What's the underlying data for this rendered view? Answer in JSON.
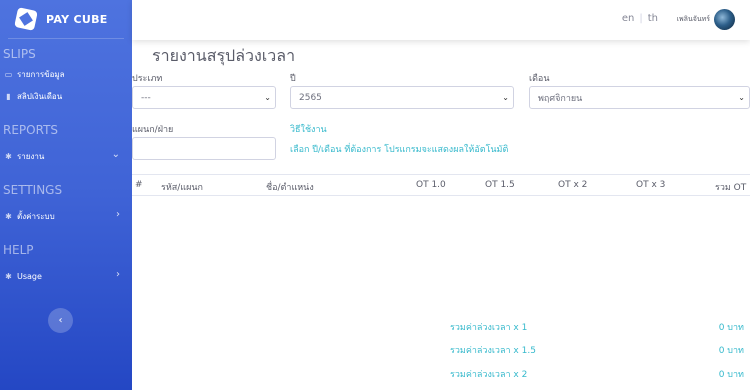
{
  "brand": {
    "name": "PAY CUBE"
  },
  "sidebar": {
    "sections": [
      {
        "title": "SLIPS",
        "items": [
          {
            "label": "รายการข้อมูล",
            "icon": "table-icon"
          },
          {
            "label": "สลิปเงินเดือน",
            "icon": "file-icon"
          }
        ]
      },
      {
        "title": "REPORTS",
        "items": [
          {
            "label": "รายงาน",
            "icon": "gear-icon"
          }
        ]
      },
      {
        "title": "SETTINGS",
        "items": [
          {
            "label": "ตั้งค่าระบบ",
            "icon": "gear-icon"
          }
        ]
      },
      {
        "title": "HELP",
        "items": [
          {
            "label": "Usage",
            "icon": "gear-icon"
          }
        ]
      }
    ],
    "collapse_label": "‹"
  },
  "topbar": {
    "lang_en": "en",
    "lang_th": "th",
    "user_name": "เพลินจันทร์"
  },
  "page": {
    "title": "รายงานสรุปล่วงเวลา"
  },
  "filters": {
    "type_label": "ประเภท",
    "type_value": "---",
    "year_label": "ปี",
    "year_value": "2565",
    "month_label": "เดือน",
    "month_value": "พฤศจิกายน",
    "dept_label": "แผนก/ฝ่าย",
    "dept_value": ""
  },
  "usage": {
    "link": "วิธีใช้งาน",
    "hint": "เลือก ปี/เดือน ที่ต้องการ โปรแกรมจะแสดงผลให้อัตโนมัติ"
  },
  "table": {
    "headers": [
      "#",
      "รหัส/แผนก",
      "ชื่อ/ตำแหน่ง",
      "OT 1.0",
      "OT 1.5",
      "OT x 2",
      "OT x 3",
      "รวม OT"
    ]
  },
  "summary": [
    {
      "label": "รวมค่าล่วงเวลา x 1",
      "value": "0 บาท"
    },
    {
      "label": "รวมค่าล่วงเวลา x 1.5",
      "value": "0 บาท"
    },
    {
      "label": "รวมค่าล่วงเวลา x 2",
      "value": "0 บาท"
    }
  ],
  "colors": {
    "sidebar": "#4e73df",
    "accent": "#36b9cc"
  }
}
